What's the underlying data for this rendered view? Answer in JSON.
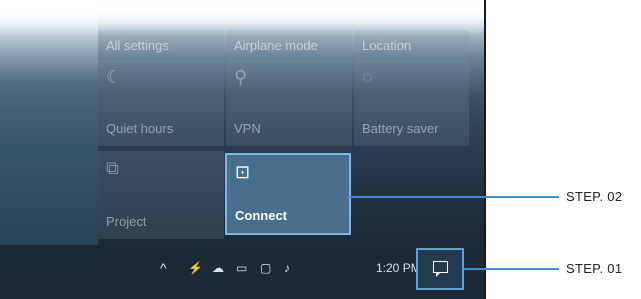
{
  "tiles_row1": [
    {
      "label": "All settings"
    },
    {
      "label": "Airplane mode"
    },
    {
      "label": "Location"
    }
  ],
  "tiles_row2": [
    {
      "label": "Quiet hours",
      "icon": "moon-icon",
      "glyph": "☾"
    },
    {
      "label": "VPN",
      "icon": "vpn-icon",
      "glyph": "⚲"
    },
    {
      "label": "Battery saver",
      "icon": "battery-saver-icon",
      "glyph": "◌"
    }
  ],
  "tiles_row3": [
    {
      "label": "Project",
      "icon": "project-icon",
      "glyph": "⧉"
    },
    {
      "label": "Connect",
      "icon": "connect-icon",
      "glyph": "⊡"
    }
  ],
  "tray": {
    "chevron": "^",
    "icons": [
      "network-icon",
      "onedrive-icon",
      "battery-icon",
      "display-icon",
      "volume-icon"
    ],
    "glyphs": [
      "⚡",
      "☁",
      "▭",
      "▢",
      "♪"
    ],
    "clock": "1:20 PM"
  },
  "callouts": {
    "step2": "STEP. 02",
    "step1": "STEP. 01"
  },
  "colors": {
    "accent": "#3b8ed6",
    "connect_tile": "#4a6f8c",
    "taskbar": "#1c2a38"
  }
}
